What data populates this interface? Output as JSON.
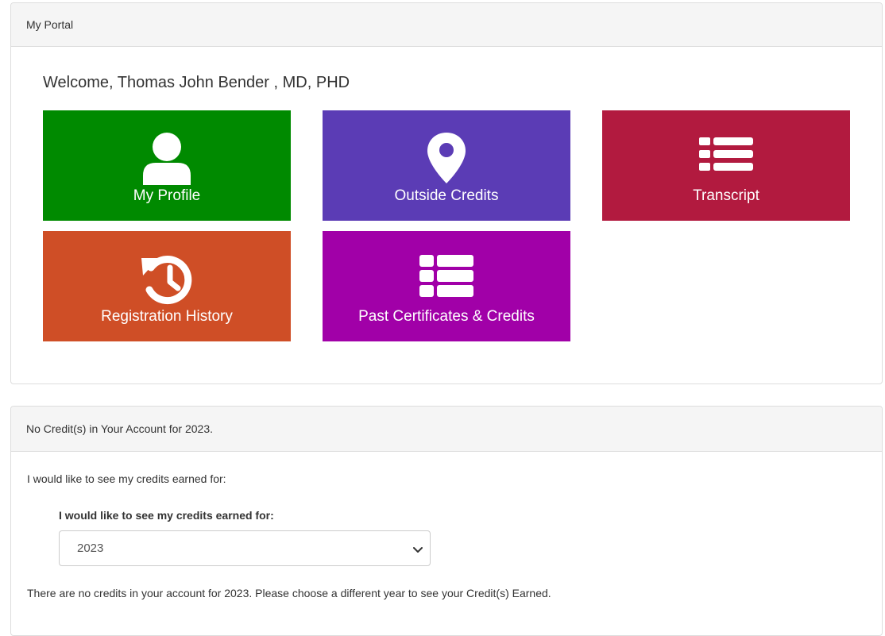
{
  "portal": {
    "title": "My Portal",
    "welcome": "Welcome, Thomas John Bender , MD, PHD",
    "tiles": [
      {
        "label": "My Profile",
        "icon": "user-icon",
        "color": "#008a00"
      },
      {
        "label": "Outside Credits",
        "icon": "map-marker-icon",
        "color": "#5b3cb5"
      },
      {
        "label": "Transcript",
        "icon": "list-icon",
        "color": "#b21a3f"
      },
      {
        "label": "Registration History",
        "icon": "history-icon",
        "color": "#cf4e26"
      },
      {
        "label": "Past Certificates & Credits",
        "icon": "table-list-icon",
        "color": "#a100a8"
      }
    ]
  },
  "credits": {
    "heading": "No Credit(s) in Your Account for 2023.",
    "intro": "I would like to see my credits earned for:",
    "select_label": "I would like to see my credits earned for:",
    "selected_year": "2023",
    "message": "There are no credits in your account for 2023. Please choose a different year to see your Credit(s) Earned."
  }
}
